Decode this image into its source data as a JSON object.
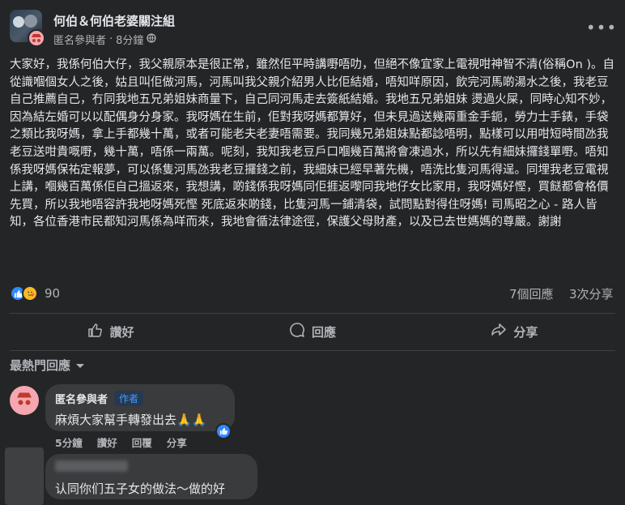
{
  "post": {
    "group_name": "何伯＆何伯老婆關注組",
    "author": "匿名參與者",
    "separator": "·",
    "time": "8分鐘",
    "text": "大家好，我係何伯大仔，我父親原本是很正常，雖然佢平時講嘢唔叻，但絕不像宜家上電視咁神智不清(俗稱On )。自從識嗰個女人之後，姑且叫佢做河馬，河馬叫我父親介紹男人比佢結婚，唔知咩原因，飲完河馬啲湯水之後，我老豆自己推薦自己，冇同我地五兄弟姐妹商量下，自己同河馬走去簽紙結婚。我地五兄弟姐妹 燙過火屎，同時心知不妙，因為結左婚可以以配偶身分身家。我呀媽在生前，佢對我呀媽都算好，但未見過送幾兩重金手鈪，勞力士手錶，手袋之類比我呀媽，拿上手都幾十萬，或者可能老夫老妻唔需要。我同幾兄弟姐妹點都諗唔明，點樣可以用咁短時間氹我老豆送咁貴嘅嘢，幾十萬，唔係一兩萬。呢刻，我知我老豆戶口嗰幾百萬將會凍過水，所以先有細妹攞錢單嘢。唔知係我呀媽保祐定報夢，可以係隻河馬氹我老豆攞錢之前，我細妹已經早著先機，唔洗比隻河馬得逞。同埋我老豆電視上講，嗰幾百萬係佢自己搵返來，我想講，啲錢係我呀媽同佢捱返嚟同我地仔女比家用，我呀媽好慳，買餸都會格價先買，所以我地唔容許我地呀媽死慳 死底返來啲錢，比隻河馬一鋪清袋，試問點對得住呀媽! 司馬昭之心 - 路人皆知，各位香港市民都知河馬係為咩而來，我地會循法律途徑，保護父母財產，以及已去世媽媽的尊嚴。謝謝",
    "reaction_count": "90",
    "comments_count": "7個回應",
    "shares_count": "3次分享",
    "more_label": "•••"
  },
  "actions": {
    "like": "讚好",
    "comment": "回應",
    "share": "分享"
  },
  "sort_label": "最熱門回應",
  "comments": [
    {
      "author": "匿名參與者",
      "badge": "作者",
      "text": "麻煩大家幫手轉發出去🙏🙏",
      "time": "5分鐘",
      "like": "讚好",
      "reply": "回覆",
      "share": "分享"
    },
    {
      "text": "认同你们五子女的做法～做的好"
    }
  ],
  "colors": {
    "background": "#242526",
    "text": "#e4e6eb",
    "secondary": "#b0b3b8",
    "accent": "#2e89ff"
  }
}
